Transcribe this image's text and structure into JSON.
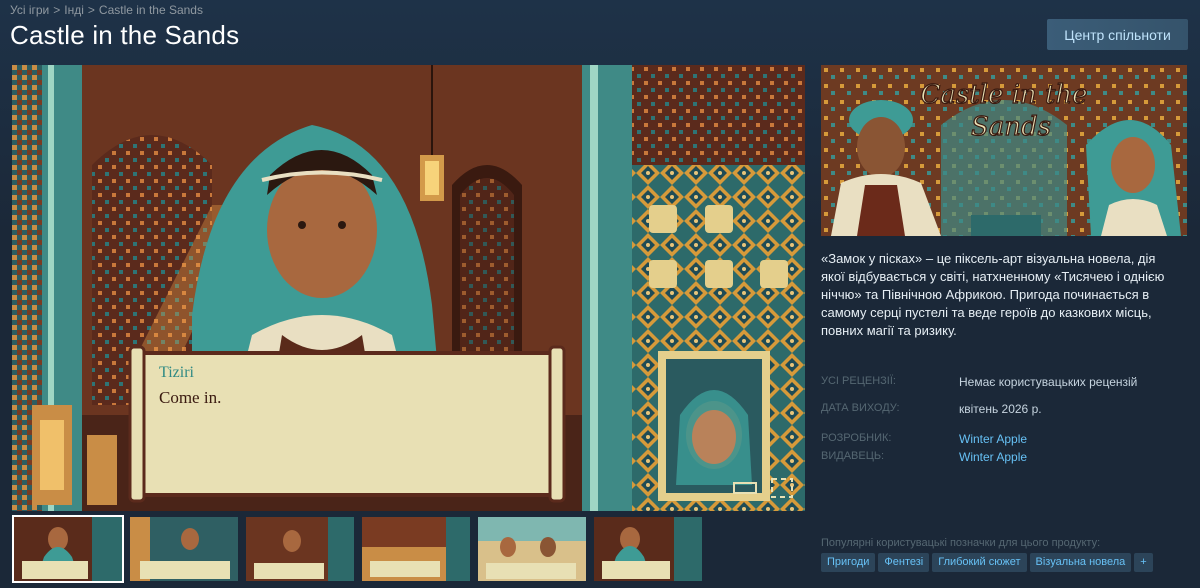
{
  "breadcrumb": {
    "items": [
      "Усі ігри",
      "Інді",
      "Castle in the Sands"
    ],
    "separator": ">"
  },
  "title": "Castle in the Sands",
  "community_button": "Центр спільноти",
  "screenshot": {
    "dialogue_speaker": "Tiziri",
    "dialogue_text": "Come in."
  },
  "capsule": {
    "logo_line1": "Castle in the",
    "logo_line2": "Sands"
  },
  "description": "«Замок у пісках» – це піксель-арт візуальна новела, дія якої відбувається у світі, натхненному «Тисячею і однією ніччю» та Північною Африкою. Пригода починається в самому серці пустелі та веде героїв до казкових місць, повних магії та ризику.",
  "info": {
    "reviews_label": "УСІ РЕЦЕНЗІЇ:",
    "reviews_value": "Немає користувацьких рецензій",
    "release_label": "ДАТА ВИХОДУ:",
    "release_value": "квітень 2026 р.",
    "developer_label": "РОЗРОБНИК:",
    "developer_value": "Winter Apple",
    "publisher_label": "ВИДАВЕЦЬ:",
    "publisher_value": "Winter Apple"
  },
  "tags_caption": "Популярні користувацькі позначки для цього продукту:",
  "tags": [
    "Пригоди",
    "Фентезі",
    "Глибокий сюжет",
    "Візуальна новела",
    "+"
  ],
  "colors": {
    "background": "#1b2838",
    "link": "#66c0f4",
    "tag_bg": "#2c4459",
    "label": "#556772"
  }
}
